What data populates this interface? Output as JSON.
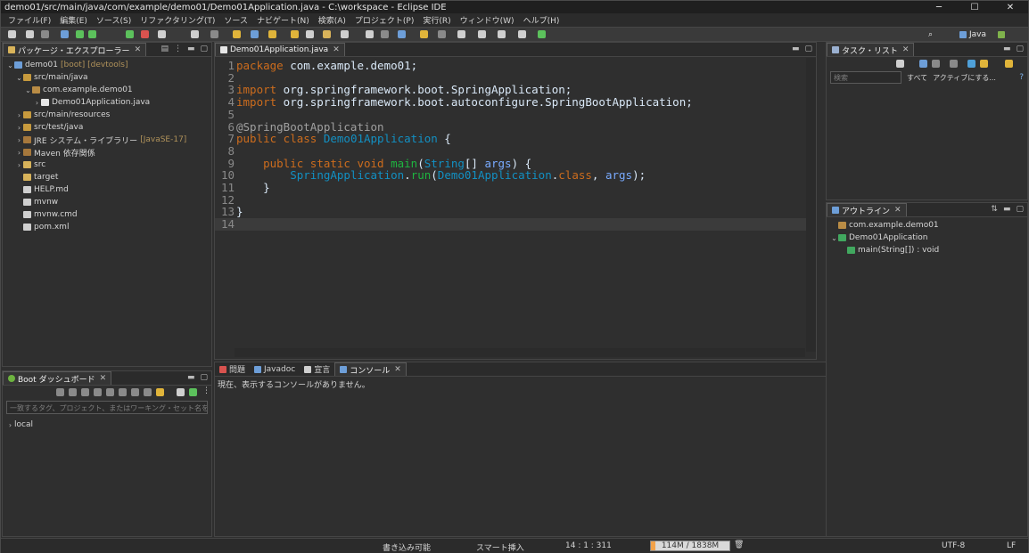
{
  "window": {
    "title": "demo01/src/main/java/com/example/demo01/Demo01Application.java - C:\\workspace - Eclipse IDE",
    "min": "─",
    "max": "☐",
    "close": "✕"
  },
  "menu": [
    "ファイル(F)",
    "編集(E)",
    "ソース(S)",
    "リファクタリング(T)",
    "ソース",
    "ナビゲート(N)",
    "検索(A)",
    "プロジェクト(P)",
    "実行(R)",
    "ウィンドウ(W)",
    "ヘルプ(H)"
  ],
  "toolbar": {
    "perspective_label": "Java"
  },
  "package_explorer": {
    "tab": "パッケージ・エクスプローラー",
    "rows": [
      {
        "indent": 0,
        "arrow": "⌄",
        "icon": "project-icon",
        "label": "demo01",
        "decoration": "[boot] [devtools]"
      },
      {
        "indent": 1,
        "arrow": "⌄",
        "icon": "source-folder-icon",
        "label": "src/main/java",
        "decoration": ""
      },
      {
        "indent": 2,
        "arrow": "⌄",
        "icon": "package-icon",
        "label": "com.example.demo01",
        "decoration": ""
      },
      {
        "indent": 3,
        "arrow": "›",
        "icon": "java-file-icon",
        "label": "Demo01Application.java",
        "decoration": ""
      },
      {
        "indent": 1,
        "arrow": "›",
        "icon": "source-folder-icon",
        "label": "src/main/resources",
        "decoration": ""
      },
      {
        "indent": 1,
        "arrow": "›",
        "icon": "source-folder-icon",
        "label": "src/test/java",
        "decoration": ""
      },
      {
        "indent": 1,
        "arrow": "›",
        "icon": "library-icon",
        "label": "JRE システム・ライブラリー",
        "decoration": "[JavaSE-17]"
      },
      {
        "indent": 1,
        "arrow": "›",
        "icon": "library-icon",
        "label": "Maven 依存関係",
        "decoration": ""
      },
      {
        "indent": 1,
        "arrow": "›",
        "icon": "folder-icon",
        "label": "src",
        "decoration": ""
      },
      {
        "indent": 1,
        "arrow": "",
        "icon": "folder-icon",
        "label": "target",
        "decoration": ""
      },
      {
        "indent": 1,
        "arrow": "",
        "icon": "file-icon",
        "label": "HELP.md",
        "decoration": ""
      },
      {
        "indent": 1,
        "arrow": "",
        "icon": "file-icon",
        "label": "mvnw",
        "decoration": ""
      },
      {
        "indent": 1,
        "arrow": "",
        "icon": "file-icon",
        "label": "mvnw.cmd",
        "decoration": ""
      },
      {
        "indent": 1,
        "arrow": "",
        "icon": "file-icon",
        "label": "pom.xml",
        "decoration": ""
      }
    ]
  },
  "boot_dashboard": {
    "tab": "Boot ダッシュボード",
    "filter_placeholder": "一致するタグ、プロジェクト、またはワーキング・セット名を入力します",
    "rows": [
      {
        "arrow": "›",
        "label": "local"
      }
    ]
  },
  "editor": {
    "tab": "Demo01Application.java",
    "lines": [
      {
        "n": "1",
        "t": [
          [
            "kw",
            "package"
          ],
          [
            "pln",
            " com.example.demo01;"
          ]
        ]
      },
      {
        "n": "2",
        "t": []
      },
      {
        "n": "3",
        "t": [
          [
            "kw",
            "import"
          ],
          [
            "pln",
            " org.springframework.boot.SpringApplication;"
          ]
        ]
      },
      {
        "n": "4",
        "t": [
          [
            "kw",
            "import"
          ],
          [
            "pln",
            " org.springframework.boot.autoconfigure.SpringBootApplication;"
          ]
        ]
      },
      {
        "n": "5",
        "t": []
      },
      {
        "n": "6",
        "t": [
          [
            "ann",
            "@SpringBootApplication"
          ]
        ]
      },
      {
        "n": "7",
        "t": [
          [
            "kw",
            "public class "
          ],
          [
            "cls",
            "Demo01Application"
          ],
          [
            "pln",
            " {"
          ]
        ]
      },
      {
        "n": "8",
        "t": []
      },
      {
        "n": "9",
        "t": [
          [
            "pln",
            "    "
          ],
          [
            "kw",
            "public static void "
          ],
          [
            "mth",
            "main"
          ],
          [
            "pln",
            "("
          ],
          [
            "cls",
            "String"
          ],
          [
            "pln",
            "[] "
          ],
          [
            "var",
            "args"
          ],
          [
            "pln",
            ") {"
          ]
        ]
      },
      {
        "n": "10",
        "t": [
          [
            "pln",
            "        "
          ],
          [
            "cls",
            "SpringApplication"
          ],
          [
            "pln",
            "."
          ],
          [
            "mth",
            "run"
          ],
          [
            "pln",
            "("
          ],
          [
            "cls",
            "Demo01Application"
          ],
          [
            "pln",
            "."
          ],
          [
            "kw",
            "class"
          ],
          [
            "pln",
            ", "
          ],
          [
            "var",
            "args"
          ],
          [
            "pln",
            ");"
          ]
        ]
      },
      {
        "n": "11",
        "t": [
          [
            "pln",
            "    }"
          ]
        ]
      },
      {
        "n": "12",
        "t": []
      },
      {
        "n": "13",
        "t": [
          [
            "pln",
            "}"
          ]
        ]
      },
      {
        "n": "14",
        "t": []
      }
    ]
  },
  "bottom": {
    "tabs": [
      "問題",
      "Javadoc",
      "宣言",
      "コンソール"
    ],
    "active": 3,
    "message": "現在、表示するコンソールがありません。"
  },
  "task_list": {
    "tab": "タスク・リスト",
    "search_placeholder": "検索",
    "all": "すべて",
    "activate": "アクティブにする..."
  },
  "outline": {
    "tab": "アウトライン",
    "rows": [
      {
        "indent": 0,
        "arrow": "",
        "icon": "package-icon",
        "label": "com.example.demo01"
      },
      {
        "indent": 0,
        "arrow": "⌄",
        "icon": "class-icon",
        "label": "Demo01Application"
      },
      {
        "indent": 1,
        "arrow": "",
        "icon": "method-icon",
        "label": "main(String[]) : void"
      }
    ]
  },
  "status": {
    "writable": "書き込み可能",
    "insert": "スマート挿入",
    "position": "14 : 1 : 311",
    "heap": "114M / 1838M",
    "heap_fraction": 0.06,
    "encoding": "UTF-8",
    "eol": "LF"
  },
  "colors": {
    "keyword": "#cc6c1d",
    "class": "#1290c3",
    "method": "#1eb540",
    "variable": "#79abff"
  }
}
